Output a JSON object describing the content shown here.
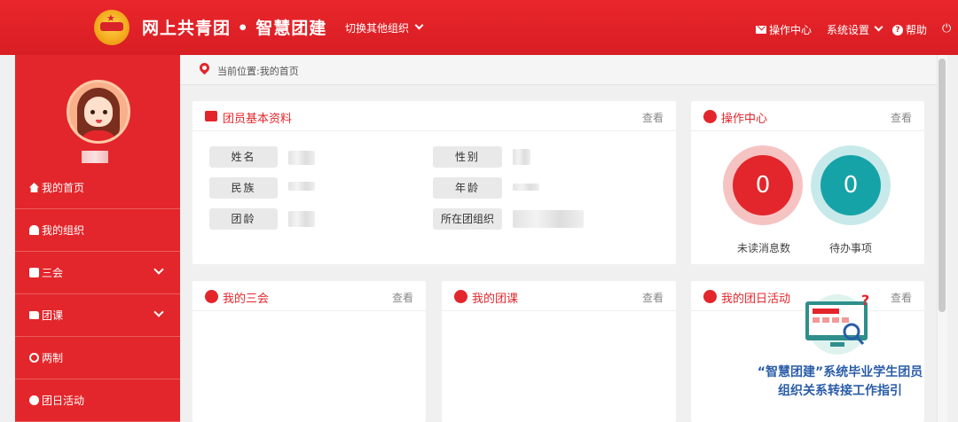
{
  "header": {
    "brand": "网上共青团 • 智慧团建",
    "switch_org": "切换其他组织",
    "ops_center": "操作中心",
    "settings": "系统设置",
    "help": "帮助"
  },
  "sidebar": {
    "items": [
      {
        "label": "我的首页",
        "icon": "home-icon"
      },
      {
        "label": "我的组织",
        "icon": "users-icon"
      },
      {
        "label": "三会",
        "icon": "edit-icon"
      },
      {
        "label": "团课",
        "icon": "folder-icon"
      },
      {
        "label": "两制",
        "icon": "circle-target-icon"
      },
      {
        "label": "团日活动",
        "icon": "recycle-icon"
      }
    ]
  },
  "breadcrumb": "当前位置:我的首页",
  "profile_card": {
    "title": "团员基本资料",
    "view": "查看",
    "fields": [
      "姓名",
      "民族",
      "团龄",
      "性别",
      "年龄",
      "所在团组织"
    ]
  },
  "ops_card": {
    "title": "操作中心",
    "view": "查看",
    "unread_count": "0",
    "unread_label": "未读消息数",
    "todo_count": "0",
    "todo_label": "待办事项",
    "colors": {
      "unread": "#e3262b",
      "todo": "#16a3a8"
    }
  },
  "meetings_card": {
    "title": "我的三会",
    "view": "查看"
  },
  "lessons_card": {
    "title": "我的团课",
    "view": "查看"
  },
  "activities_card": {
    "title": "我的团日活动",
    "view": "查看"
  },
  "promo": {
    "line1": "“智慧团建”系统毕业学生团员",
    "line2": "组织关系转接工作指引"
  }
}
